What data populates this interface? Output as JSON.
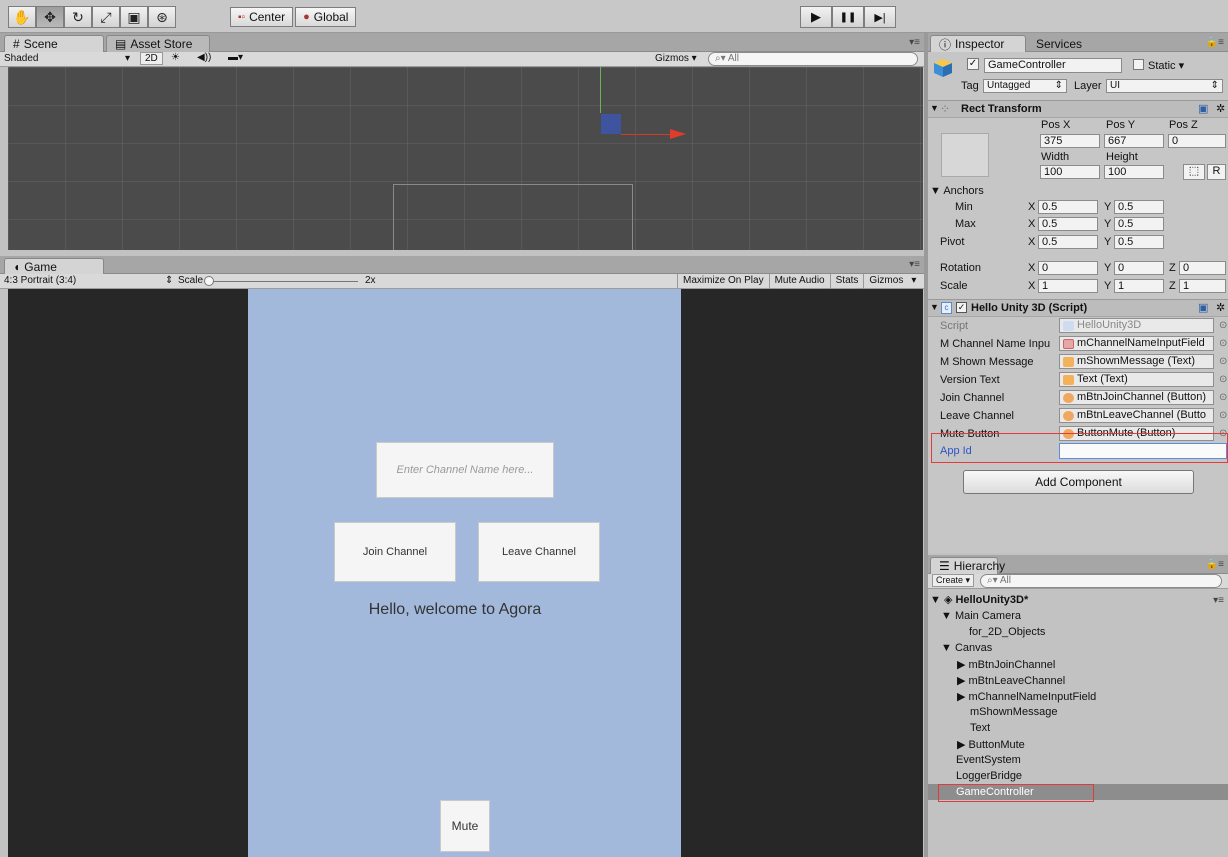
{
  "toolbar": {
    "tools": [
      "hand-tool",
      "move-tool",
      "rotate-tool",
      "scale-tool",
      "rect-tool",
      "transform-tool"
    ],
    "pivot_label": "Center",
    "space_label": "Global",
    "play": "▶",
    "pause": "❚❚",
    "step": "▶|"
  },
  "scene": {
    "tab_scene": "Scene",
    "tab_asset_store": "Asset Store",
    "shading_mode": "Shaded",
    "mode_2d": "2D",
    "gizmos": "Gizmos",
    "search_placeholder": "All"
  },
  "game": {
    "tab": "Game",
    "aspect": "4:3 Portrait (3:4)",
    "scale_label": "Scale",
    "scale_value": "2x",
    "options": [
      "Maximize On Play",
      "Mute Audio",
      "Stats",
      "Gizmos"
    ],
    "channel_input_placeholder": "Enter Channel Name here...",
    "join_button": "Join Channel",
    "leave_button": "Leave Channel",
    "message": "Hello, welcome to Agora",
    "mute_button": "Mute",
    "canvas_color": "#a3b9dc"
  },
  "inspector": {
    "tab_inspector": "Inspector",
    "tab_services": "Services",
    "object_name": "GameController",
    "static_label": "Static",
    "tag_label": "Tag",
    "tag_value": "Untagged",
    "layer_label": "Layer",
    "layer_value": "UI",
    "rect_transform": {
      "title": "Rect Transform",
      "pos_x_label": "Pos X",
      "pos_y_label": "Pos Y",
      "pos_z_label": "Pos Z",
      "pos_x": "375",
      "pos_y": "667",
      "pos_z": "0",
      "width_label": "Width",
      "height_label": "Height",
      "width": "100",
      "height": "100",
      "r_label": "R",
      "anchors_label": "Anchors",
      "min_label": "Min",
      "max_label": "Max",
      "min_x": "0.5",
      "min_y": "0.5",
      "max_x": "0.5",
      "max_y": "0.5",
      "pivot_label": "Pivot",
      "pivot_x": "0.5",
      "pivot_y": "0.5",
      "rotation_label": "Rotation",
      "rot_x": "0",
      "rot_y": "0",
      "rot_z": "0",
      "scale_label": "Scale",
      "scale_x": "1",
      "scale_y": "1",
      "scale_z": "1",
      "x": "X",
      "y": "Y",
      "z": "Z"
    },
    "script_component": {
      "title": "Hello Unity 3D (Script)",
      "script_label": "Script",
      "script_value": "HelloUnity3D",
      "fields": [
        {
          "label": "M Channel Name Inpu",
          "value": "mChannelNameInputField"
        },
        {
          "label": "M Shown Message",
          "value": "mShownMessage (Text)"
        },
        {
          "label": "Version Text",
          "value": "Text (Text)"
        },
        {
          "label": "Join Channel",
          "value": "mBtnJoinChannel (Button)"
        },
        {
          "label": "Leave Channel",
          "value": "mBtnLeaveChannel (Butto"
        },
        {
          "label": "Mute Button",
          "value": "ButtonMute (Button)"
        }
      ],
      "app_id_label": "App Id",
      "app_id_value": ""
    },
    "add_component": "Add Component"
  },
  "hierarchy": {
    "tab": "Hierarchy",
    "create_label": "Create",
    "search_placeholder": "All",
    "scene_name": "HelloUnity3D*",
    "items": {
      "main_camera": "Main Camera",
      "for_2d": "for_2D_Objects",
      "canvas": "Canvas",
      "join": "mBtnJoinChannel",
      "leave": "mBtnLeaveChannel",
      "input": "mChannelNameInputField",
      "shown": "mShownMessage",
      "text": "Text",
      "mute": "ButtonMute",
      "event_system": "EventSystem",
      "logger": "LoggerBridge",
      "game_controller": "GameController"
    }
  }
}
